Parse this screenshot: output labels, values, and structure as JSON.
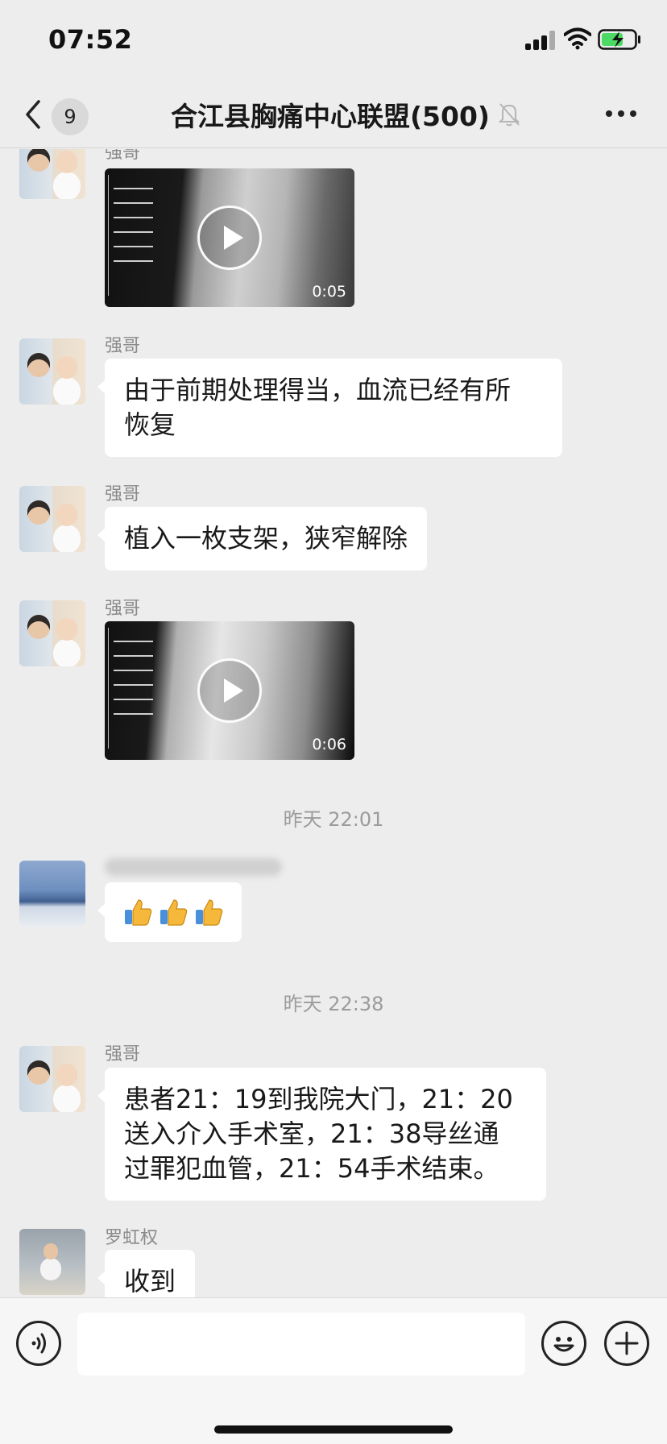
{
  "status_bar": {
    "time": "07:52"
  },
  "nav": {
    "unread_count": "9",
    "title": "合江县胸痛中心联盟(500)"
  },
  "messages": [
    {
      "type": "video",
      "sender": "强哥",
      "duration": "0:05"
    },
    {
      "type": "text",
      "sender": "强哥",
      "lines": [
        "由于前期处理得当，血流已经有所",
        "恢复"
      ]
    },
    {
      "type": "text",
      "sender": "强哥",
      "lines": [
        "植入一枚支架，狭窄解除"
      ]
    },
    {
      "type": "video",
      "sender": "强哥",
      "duration": "0:06"
    },
    {
      "type": "timestamp",
      "text": "昨天 22:01"
    },
    {
      "type": "emoji",
      "sender": "",
      "emojis": [
        "thumbs-up",
        "thumbs-up",
        "thumbs-up"
      ]
    },
    {
      "type": "timestamp",
      "text": "昨天 22:38"
    },
    {
      "type": "text",
      "sender": "强哥",
      "lines": [
        "患者21：19到我院大门，21：20",
        "送入介入手术室，21：38导丝通",
        "过罪犯血管，21：54手术结束。"
      ]
    },
    {
      "type": "text",
      "sender": "罗虹权",
      "lines": [
        "收到"
      ]
    }
  ],
  "input": {
    "value": ""
  },
  "colors": {
    "background": "#ededed",
    "bubble": "#ffffff",
    "meta_text": "#8a8a8a",
    "thumb": "#f5b83a"
  }
}
